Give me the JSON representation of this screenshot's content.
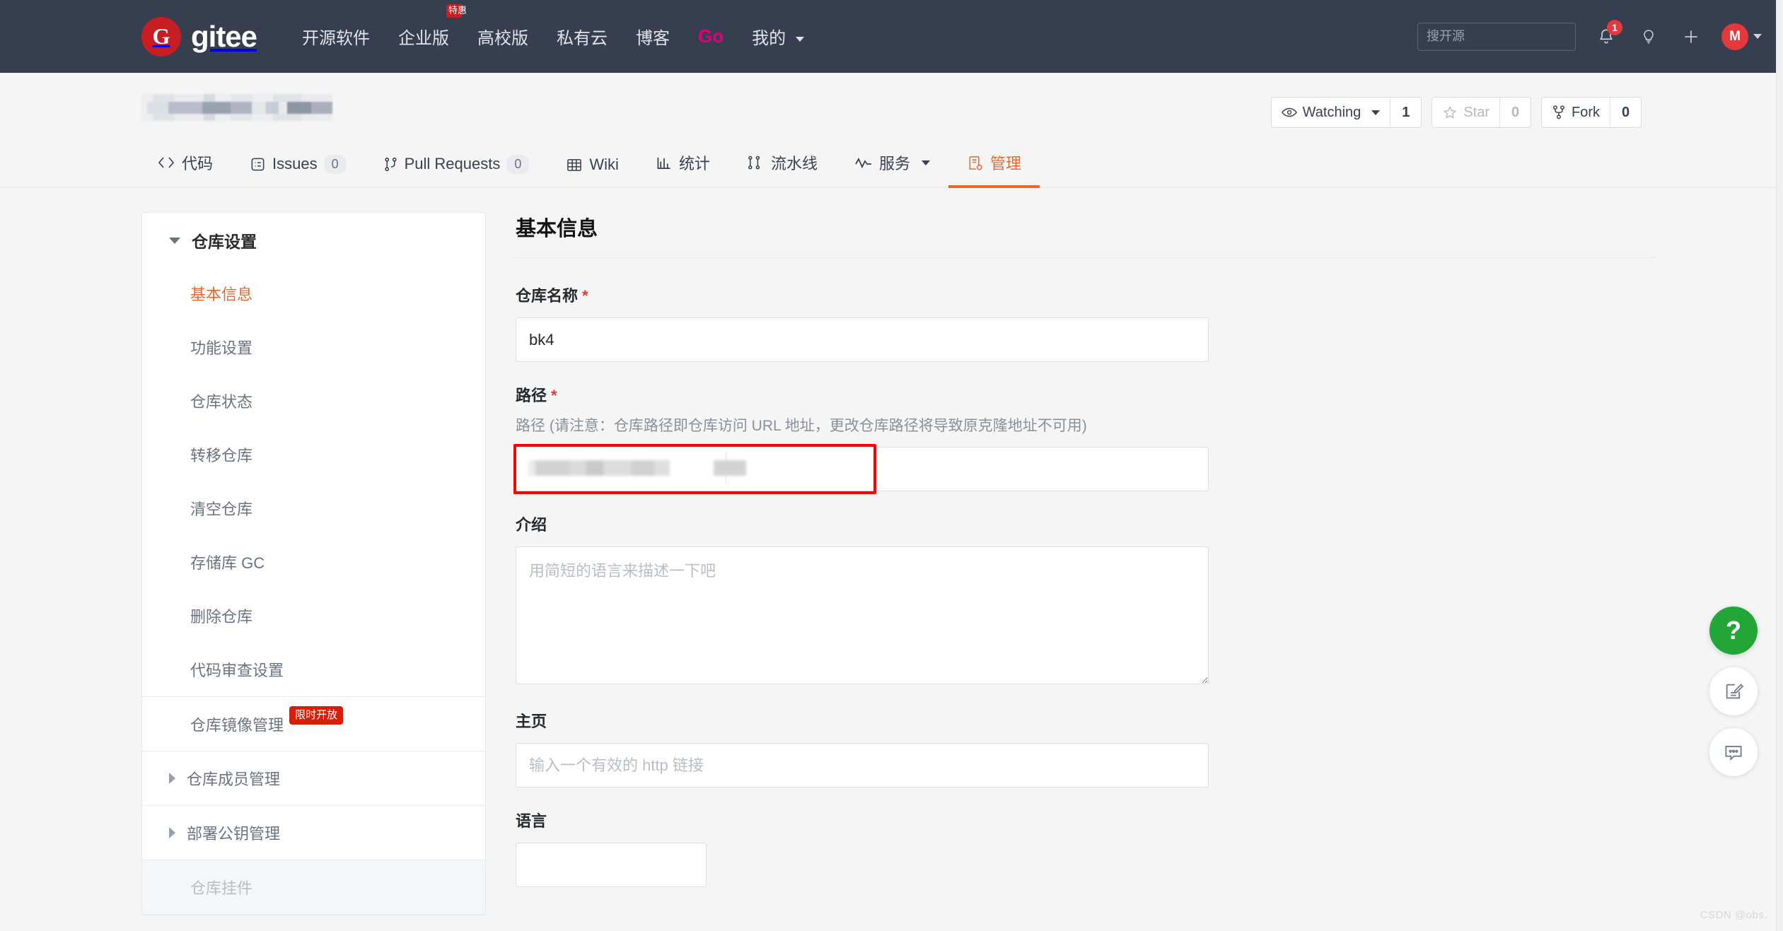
{
  "navbar": {
    "brand_letter": "G",
    "brand_name": "gitee",
    "links": [
      {
        "label": "开源软件",
        "badge": null,
        "caret": false,
        "style": "plain"
      },
      {
        "label": "企业版",
        "badge": "特惠",
        "caret": false,
        "style": "plain"
      },
      {
        "label": "高校版",
        "badge": null,
        "caret": false,
        "style": "plain"
      },
      {
        "label": "私有云",
        "badge": null,
        "caret": false,
        "style": "plain"
      },
      {
        "label": "博客",
        "badge": null,
        "caret": false,
        "style": "plain"
      },
      {
        "label": "Go",
        "badge": null,
        "caret": false,
        "style": "go"
      },
      {
        "label": "我的",
        "badge": null,
        "caret": true,
        "style": "plain"
      }
    ],
    "search_placeholder": "搜开源",
    "search_value": "",
    "notification_count": "1",
    "avatar_letter": "M"
  },
  "repo": {
    "title_redacted": "",
    "actions": {
      "watch_label": "Watching",
      "watch_count": "1",
      "star_label": "Star",
      "star_count": "0",
      "fork_label": "Fork",
      "fork_count": "0"
    },
    "tabs": [
      {
        "label": "代码",
        "icon": "code-icon",
        "count": null,
        "active": false,
        "caret": false
      },
      {
        "label": "Issues",
        "icon": "issue-icon",
        "count": "0",
        "active": false,
        "caret": false
      },
      {
        "label": "Pull Requests",
        "icon": "pr-icon",
        "count": "0",
        "active": false,
        "caret": false
      },
      {
        "label": "Wiki",
        "icon": "book-icon",
        "count": null,
        "active": false,
        "caret": false
      },
      {
        "label": "统计",
        "icon": "chart-icon",
        "count": null,
        "active": false,
        "caret": false
      },
      {
        "label": "流水线",
        "icon": "pipeline-icon",
        "count": null,
        "active": false,
        "caret": false
      },
      {
        "label": "服务",
        "icon": "pulse-icon",
        "count": null,
        "active": false,
        "caret": true
      },
      {
        "label": "管理",
        "icon": "manage-icon",
        "count": null,
        "active": true,
        "caret": false
      }
    ]
  },
  "sidebar": {
    "group_title": "仓库设置",
    "items": [
      {
        "label": "基本信息",
        "active": true,
        "disabled": false,
        "badge": null,
        "separator_before": false
      },
      {
        "label": "功能设置",
        "active": false,
        "disabled": false,
        "badge": null,
        "separator_before": false
      },
      {
        "label": "仓库状态",
        "active": false,
        "disabled": false,
        "badge": null,
        "separator_before": false
      },
      {
        "label": "转移仓库",
        "active": false,
        "disabled": false,
        "badge": null,
        "separator_before": false
      },
      {
        "label": "清空仓库",
        "active": false,
        "disabled": false,
        "badge": null,
        "separator_before": false
      },
      {
        "label": "存储库 GC",
        "active": false,
        "disabled": false,
        "badge": null,
        "separator_before": false
      },
      {
        "label": "删除仓库",
        "active": false,
        "disabled": false,
        "badge": null,
        "separator_before": false
      },
      {
        "label": "代码审查设置",
        "active": false,
        "disabled": false,
        "badge": null,
        "separator_before": false
      },
      {
        "label": "仓库镜像管理",
        "active": false,
        "disabled": false,
        "badge": "限时开放",
        "separator_before": true
      }
    ],
    "collapsed_groups": [
      {
        "label": "仓库成员管理"
      },
      {
        "label": "部署公钥管理"
      }
    ],
    "disabled_item": {
      "label": "仓库挂件"
    }
  },
  "form": {
    "page_title": "基本信息",
    "repo_name": {
      "label": "仓库名称",
      "required_mark": "*",
      "value": "bk4",
      "placeholder": ""
    },
    "path": {
      "label": "路径",
      "required_mark": "*",
      "hint": "路径 (请注意：仓库路径即仓库访问 URL 地址，更改仓库路径将导致原克隆地址不可用)",
      "value_redacted": ""
    },
    "intro": {
      "label": "介绍",
      "placeholder": "用简短的语言来描述一下吧",
      "value": ""
    },
    "homepage": {
      "label": "主页",
      "placeholder": "输入一个有效的 http 链接",
      "value": ""
    },
    "language": {
      "label": "语言",
      "value": ""
    }
  },
  "floating": {
    "help_label": "?",
    "feedback_icon": "edit-note-icon",
    "chat_icon": "chat-bubble-icon"
  },
  "watermark": "CSDN @obs.",
  "colors": {
    "navbar_bg": "#363e4f",
    "brand_red": "#c71d23",
    "accent_orange": "#e9692c",
    "page_bg": "#f5f5f5",
    "badge_red": "#d81e06",
    "go_pink": "#e1007b",
    "help_green": "#23a638",
    "highlight_red": "#ff0000"
  }
}
